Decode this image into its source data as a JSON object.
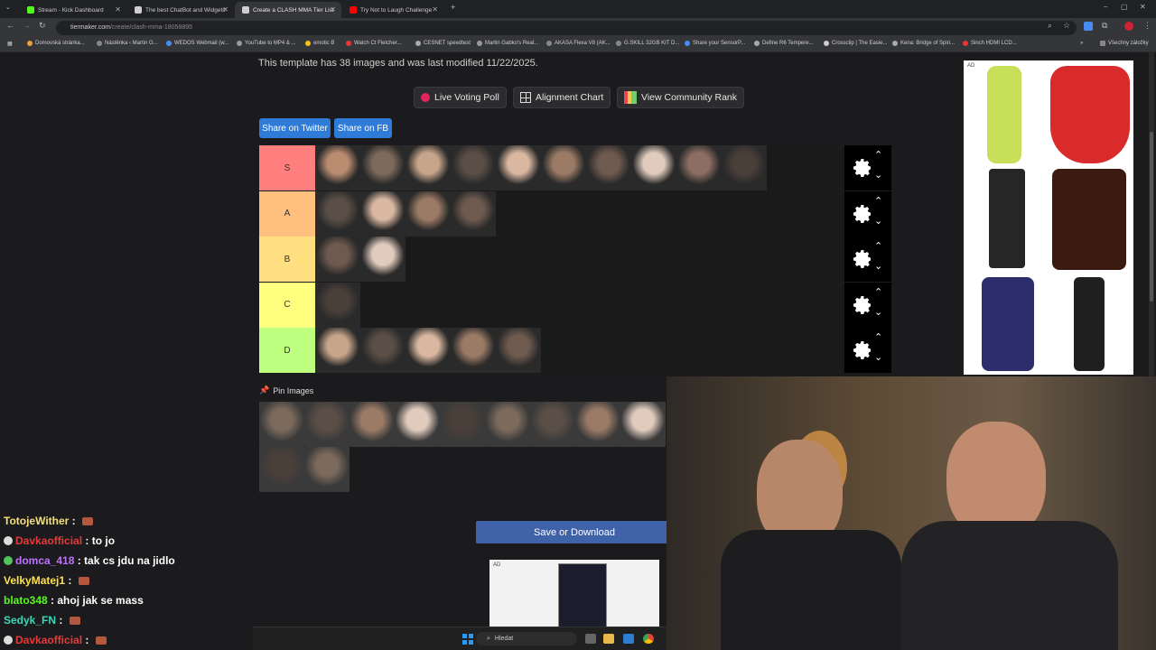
{
  "browser": {
    "tabs": [
      {
        "title": "Stream - Kick Dashboard",
        "color": "#53fc18"
      },
      {
        "title": "The best ChatBot and Widgets",
        "color": "#cfcfcf"
      },
      {
        "title": "Create a CLASH MMA Tier List",
        "color": "#cfcfcf"
      },
      {
        "title": "Try Not to Laugh Challenge",
        "color": "#ff0000"
      }
    ],
    "url_domain": "tiermaker.com",
    "url_path": "/create/clash-mma-18058895",
    "bookmarks": [
      "Domovská stránka...",
      "Nástěnka ‹ Martin G...",
      "WEDOS Webmail (w...",
      "YouTube to MP4 & ...",
      "emotic B",
      "Watch Ct Fletcher...",
      "CESNET speedtest",
      "Martin Gabko's Real...",
      "AKASA Flexa V8 (AK...",
      "G.SKILL 32GB KIT D...",
      "Share your SensorP...",
      "Define R6 Tempere...",
      "Crossclip | The Easie...",
      "Kena: Bridge of Spiri...",
      "Sinch HDMI LCD...",
      "Všechny záložky"
    ]
  },
  "page": {
    "template_info": "This template has 38 images and was last modified 11/22/2025.",
    "buttons": {
      "live_voting": "Live Voting Poll",
      "alignment": "Alignment Chart",
      "community_rank": "View Community Rank",
      "share_twitter": "Share on Twitter",
      "share_fb": "Share on FB"
    },
    "tiers": [
      {
        "label": "S",
        "color": "#ff7f7f",
        "count": 10
      },
      {
        "label": "A",
        "color": "#ffbf7f",
        "count": 4
      },
      {
        "label": "B",
        "color": "#ffdf7f",
        "count": 2
      },
      {
        "label": "C",
        "color": "#ffff7f",
        "count": 1
      },
      {
        "label": "D",
        "color": "#bfff7f",
        "count": 5
      }
    ],
    "pin_label": "Pin Images",
    "pin_count": 11,
    "save_label": "Save or Download",
    "ad_badge": "AD"
  },
  "chat": [
    {
      "user": "TotojeWither",
      "color": "#f4e07a",
      "text": "",
      "badge": false,
      "emote": true
    },
    {
      "user": "Davkaofficial",
      "color": "#e63a3a",
      "text": "to jo",
      "badge": true,
      "emote": false
    },
    {
      "user": "domca_418",
      "color": "#c072ff",
      "text": "tak cs jdu na jidlo",
      "badge": true,
      "emote": false
    },
    {
      "user": "VelkyMatej1",
      "color": "#ffe14d",
      "text": "",
      "badge": false,
      "emote": true
    },
    {
      "user": "blato348",
      "color": "#53fc18",
      "text": "ahoj jak se mass",
      "badge": false,
      "emote": false
    },
    {
      "user": "Sedyk_FN",
      "color": "#3fd7b8",
      "text": "",
      "badge": false,
      "emote": true
    },
    {
      "user": "Davkaofficial",
      "color": "#e63a3a",
      "text": "",
      "badge": true,
      "emote": true
    }
  ],
  "taskbar": {
    "search_placeholder": "Hledat"
  }
}
